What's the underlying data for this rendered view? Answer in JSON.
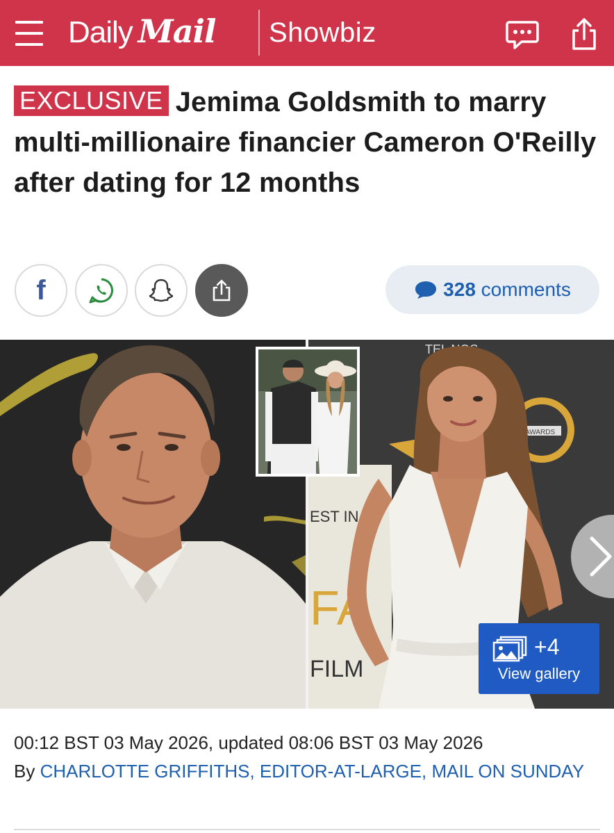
{
  "colors": {
    "brand": "#d0344a",
    "link": "#1e5fb0",
    "gallery_button": "#1f5bc2",
    "comments_pill_bg": "#e8edf3"
  },
  "header": {
    "menu_icon": "hamburger-menu-icon",
    "logo_word_1": "Daily",
    "logo_word_2": "Mail",
    "section": "Showbiz",
    "comments_icon": "speech-bubble-icon",
    "share_icon": "share-icon"
  },
  "article": {
    "badge": "EXCLUSIVE",
    "headline": "Jemima Goldsmith to marry multi-millionaire financier Cameron O'Reilly after dating for 12 months",
    "share_buttons": [
      {
        "icon": "facebook-icon",
        "label": "f"
      },
      {
        "icon": "whatsapp-icon"
      },
      {
        "icon": "snapchat-icon"
      },
      {
        "icon": "share-icon"
      }
    ],
    "comments": {
      "icon": "comment-bubble-icon",
      "count": "328",
      "label": "comments"
    },
    "hero": {
      "sign_top": "TEL  NOS",
      "sign_awards": "AWARDS",
      "sign_fest": "EST IN",
      "sign_fa": "FA",
      "sign_film": "FILM",
      "next_icon": "chevron-right-icon",
      "gallery": {
        "icon": "image-stack-icon",
        "count": "+4",
        "label": "View gallery"
      }
    },
    "timestamp": "00:12 BST 03 May 2026, updated 08:06 BST 03 May 2026",
    "byline_prefix": "By",
    "byline_author": "CHARLOTTE GRIFFITHS, EDITOR-AT-LARGE, MAIL ON SUNDAY"
  }
}
